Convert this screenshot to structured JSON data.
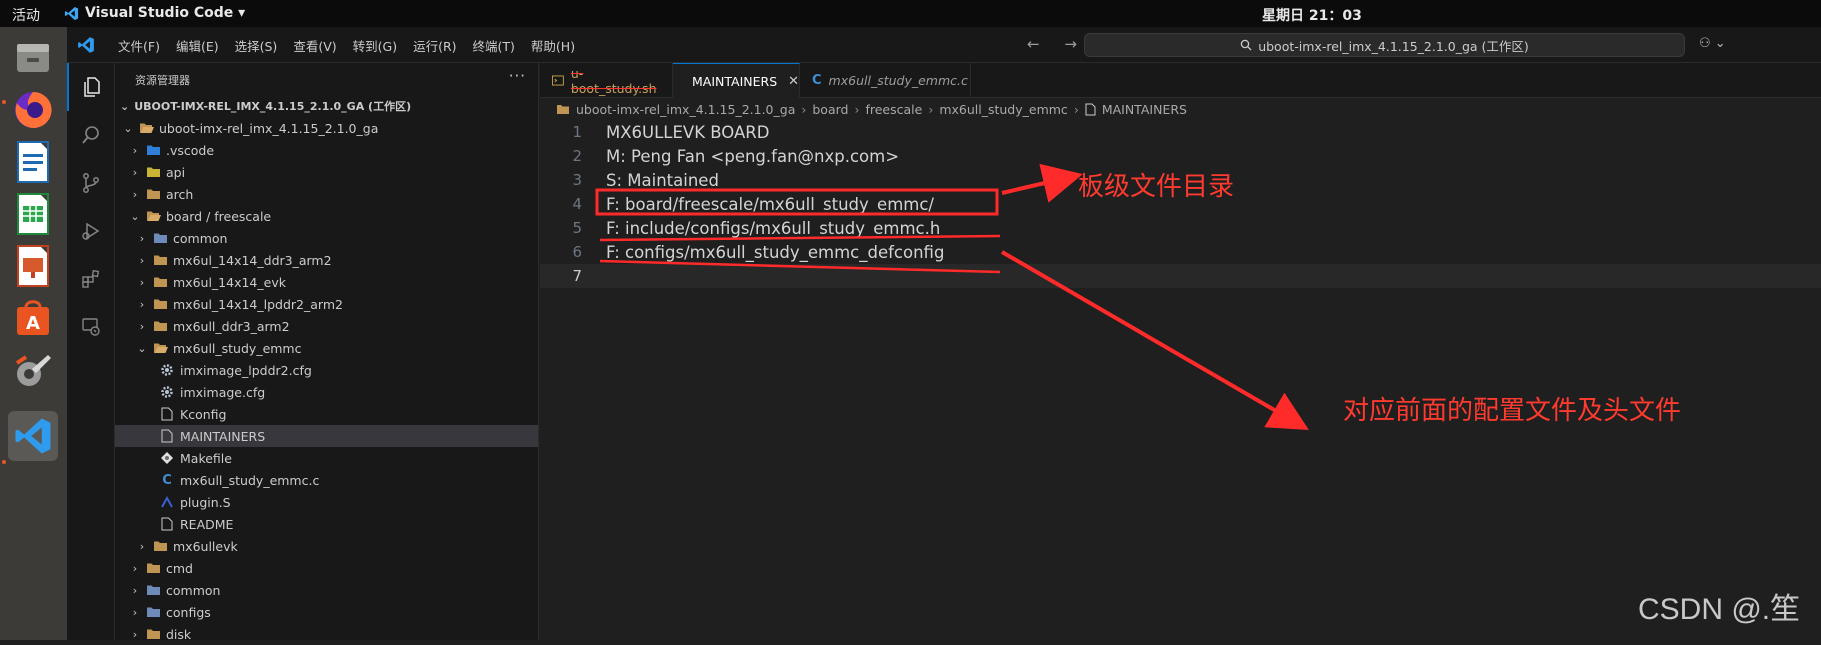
{
  "topbar": {
    "activities": "活动",
    "app_name": "Visual Studio Code ▾",
    "clock": "星期日 21：03"
  },
  "dock": {
    "items": [
      "files-app",
      "firefox",
      "libreoffice-writer",
      "libreoffice-calc",
      "libreoffice-impress",
      "ubuntu-software",
      "settings",
      "visual-studio-code"
    ]
  },
  "menu": [
    "文件(F)",
    "编辑(E)",
    "选择(S)",
    "查看(V)",
    "转到(G)",
    "运行(R)",
    "终端(T)",
    "帮助(H)"
  ],
  "titlebar": {
    "nav": "← →",
    "search_text": "uboot-imx-rel_imx_4.1.15_2.1.0_ga (工作区)",
    "copilot": "⚇ ⌄"
  },
  "sidebar": {
    "title": "资源管理器",
    "more": "···",
    "workspace_root": "UBOOT-IMX-REL_IMX_4.1.15_2.1.0_GA (工作区)",
    "tree": [
      {
        "label": "uboot-imx-rel_imx_4.1.15_2.1.0_ga",
        "depth": 1,
        "chev": "⌄",
        "icon": "folder-open"
      },
      {
        "label": ".vscode",
        "depth": 2,
        "chev": "›",
        "icon": "folder-vscode"
      },
      {
        "label": "api",
        "depth": 2,
        "chev": "›",
        "icon": "folder-api"
      },
      {
        "label": "arch",
        "depth": 2,
        "chev": "›",
        "icon": "folder"
      },
      {
        "label": "board / freescale",
        "depth": 2,
        "chev": "⌄",
        "icon": "folder-open"
      },
      {
        "label": "common",
        "depth": 3,
        "chev": "›",
        "icon": "folder-common"
      },
      {
        "label": "mx6ul_14x14_ddr3_arm2",
        "depth": 3,
        "chev": "›",
        "icon": "folder"
      },
      {
        "label": "mx6ul_14x14_evk",
        "depth": 3,
        "chev": "›",
        "icon": "folder"
      },
      {
        "label": "mx6ul_14x14_lpddr2_arm2",
        "depth": 3,
        "chev": "›",
        "icon": "folder"
      },
      {
        "label": "mx6ull_ddr3_arm2",
        "depth": 3,
        "chev": "›",
        "icon": "folder"
      },
      {
        "label": "mx6ull_study_emmc",
        "depth": 3,
        "chev": "⌄",
        "icon": "folder-open"
      },
      {
        "label": "imximage_lpddr2.cfg",
        "depth": 4,
        "chev": "",
        "icon": "gear"
      },
      {
        "label": "imximage.cfg",
        "depth": 4,
        "chev": "",
        "icon": "gear"
      },
      {
        "label": "Kconfig",
        "depth": 4,
        "chev": "",
        "icon": "file"
      },
      {
        "label": "MAINTAINERS",
        "depth": 4,
        "chev": "",
        "icon": "file",
        "selected": true
      },
      {
        "label": "Makefile",
        "depth": 4,
        "chev": "",
        "icon": "makefile"
      },
      {
        "label": "mx6ull_study_emmc.c",
        "depth": 4,
        "chev": "",
        "icon": "c-file"
      },
      {
        "label": "plugin.S",
        "depth": 4,
        "chev": "",
        "icon": "asm-file"
      },
      {
        "label": "README",
        "depth": 4,
        "chev": "",
        "icon": "file"
      },
      {
        "label": "mx6ullevk",
        "depth": 3,
        "chev": "›",
        "icon": "folder"
      },
      {
        "label": "cmd",
        "depth": 2,
        "chev": "›",
        "icon": "folder-cmd"
      },
      {
        "label": "common",
        "depth": 2,
        "chev": "›",
        "icon": "folder-common"
      },
      {
        "label": "configs",
        "depth": 2,
        "chev": "›",
        "icon": "folder-config"
      },
      {
        "label": "disk",
        "depth": 2,
        "chev": "›",
        "icon": "folder"
      }
    ]
  },
  "tabs": [
    {
      "label": "u-boot_study.sh",
      "active": false,
      "icon": "terminal-file-icon"
    },
    {
      "label": "MAINTAINERS",
      "active": true,
      "icon": "file-icon",
      "close": "✕"
    },
    {
      "label": "mx6ull_study_emmc.c",
      "active": false,
      "icon": "c-file-icon"
    }
  ],
  "breadcrumb": [
    "uboot-imx-rel_imx_4.1.15_2.1.0_ga",
    "board",
    "freescale",
    "mx6ull_study_emmc",
    "MAINTAINERS"
  ],
  "editor": {
    "lines": [
      {
        "n": "1",
        "text": "MX6ULLEVK BOARD"
      },
      {
        "n": "2",
        "text": "M:  Peng Fan <peng.fan@nxp.com>"
      },
      {
        "n": "3",
        "text": "S:  Maintained"
      },
      {
        "n": "4",
        "text": "F:  board/freescale/mx6ull_study_emmc/"
      },
      {
        "n": "5",
        "text": "F:  include/configs/mx6ull_study_emmc.h"
      },
      {
        "n": "6",
        "text": "F:  configs/mx6ull_study_emmc_defconfig"
      },
      {
        "n": "7",
        "text": ""
      }
    ],
    "current_line": "7"
  },
  "annotations": {
    "board_dir_note": "板级文件目录",
    "config_note": "对应前面的配置文件及头文件",
    "accent": "#ff2a2a"
  },
  "watermark": "CSDN @.笙"
}
